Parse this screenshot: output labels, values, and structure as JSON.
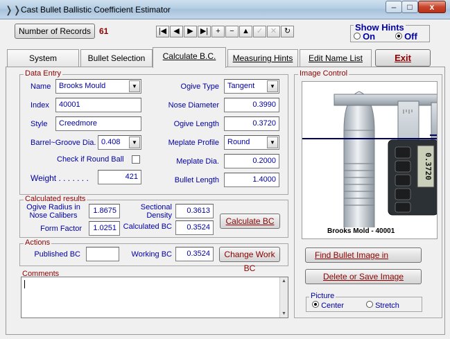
{
  "window": {
    "title": "Cast Bullet Ballistic Coefficient Estimator",
    "minimize_glyph": "–",
    "maximize_glyph": "□",
    "close_glyph": "x"
  },
  "toolbar": {
    "records_button": "Number of Records",
    "records_count": "61",
    "nav_buttons": [
      {
        "name": "first-record-icon",
        "glyph": "|◀",
        "enabled": true
      },
      {
        "name": "prev-record-icon",
        "glyph": "◀",
        "enabled": true
      },
      {
        "name": "next-record-icon",
        "glyph": "▶",
        "enabled": true
      },
      {
        "name": "last-record-icon",
        "glyph": "▶|",
        "enabled": true
      },
      {
        "name": "add-record-icon",
        "glyph": "+",
        "enabled": true
      },
      {
        "name": "delete-record-icon",
        "glyph": "−",
        "enabled": true
      },
      {
        "name": "edit-record-icon",
        "glyph": "▲",
        "enabled": true
      },
      {
        "name": "save-record-icon",
        "glyph": "✓",
        "enabled": false
      },
      {
        "name": "cancel-record-icon",
        "glyph": "✕",
        "enabled": false
      },
      {
        "name": "refresh-icon",
        "glyph": "↻",
        "enabled": true
      }
    ]
  },
  "hints": {
    "title": "Show Hints",
    "on_label": "On",
    "off_label": "Off",
    "selected": "Off"
  },
  "tabs": [
    {
      "label": "System",
      "active": false
    },
    {
      "label": "Bullet Selection",
      "active": false
    },
    {
      "label": "Calculate B.C.",
      "active": true
    },
    {
      "label": "Measuring Hints",
      "active": false
    },
    {
      "label": "Edit Name List",
      "active": false
    },
    {
      "label": "Exit",
      "active": false
    }
  ],
  "data_entry": {
    "title": "Data Entry",
    "name_label": "Name",
    "name_value": "Brooks Mould",
    "index_label": "Index",
    "index_value": "40001",
    "style_label": "Style",
    "style_value": "Creedmore",
    "barrel_label": "Barrel~Groove Dia.",
    "barrel_value": "0.408",
    "round_ball_label": "Check if Round Ball",
    "round_ball_checked": false,
    "weight_label": "Weight . . . . . . .",
    "weight_value": "421",
    "ogive_type_label": "Ogive Type",
    "ogive_type_value": "Tangent",
    "nose_dia_label": "Nose Diameter",
    "nose_dia_value": "0.3990",
    "ogive_len_label": "Ogive Length",
    "ogive_len_value": "0.3720",
    "meplate_profile_label": "Meplate Profile",
    "meplate_profile_value": "Round",
    "meplate_dia_label": "Meplate Dia.",
    "meplate_dia_value": "0.2000",
    "bullet_len_label": "Bullet Length",
    "bullet_len_value": "1.4000"
  },
  "calculated": {
    "title": "Calculated results",
    "ogive_radius_label_1": "Ogive Radius in",
    "ogive_radius_label_2": "Nose Calibers",
    "ogive_radius_value": "1.8675",
    "form_factor_label": "Form Factor",
    "form_factor_value": "1.0251",
    "sectional_label_1": "Sectional",
    "sectional_label_2": "Density",
    "sectional_value": "0.3613",
    "calc_bc_label": "Calculated BC",
    "calc_bc_value": "0.3524",
    "calc_button": "Calculate BC"
  },
  "actions": {
    "title": "Actions",
    "published_label": "Published BC",
    "published_value": "",
    "working_label": "Working BC",
    "working_value": "0.3524",
    "change_button": "Change Work BC"
  },
  "comments": {
    "title": "Comments",
    "value": ""
  },
  "image_control": {
    "title": "Image Control",
    "caption": "Brooks Mold - 40001",
    "caliper_reading": "0.3720",
    "find_button": "Find Bullet Image in",
    "delete_save_button": "Delete or Save Image",
    "picture_title": "Picture",
    "center_label": "Center",
    "stretch_label": "Stretch",
    "picture_selected": "Center"
  }
}
